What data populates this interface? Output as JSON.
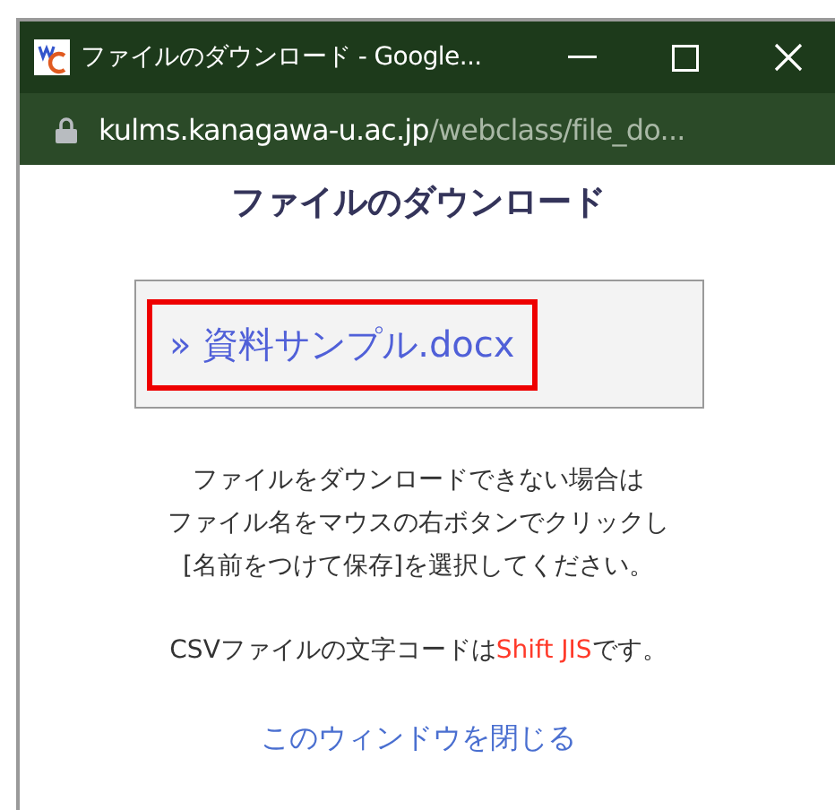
{
  "window": {
    "title": "ファイルのダウンロード - Google..."
  },
  "address_bar": {
    "host": "kulms.kanagawa-u.ac.jp",
    "path": "/webclass/file_do..."
  },
  "heading": "ファイルのダウンロード",
  "file_link": {
    "text": "» 資料サンプル.docx",
    "highlighted": true
  },
  "instructions": [
    "ファイルをダウンロードできない場合は",
    "ファイル名をマウスの右ボタンでクリックし",
    "[名前をつけて保存]を選択してください。"
  ],
  "csv_note": {
    "before": "CSVファイルの文字コードは",
    "emphasis": "Shift JIS",
    "after": "です。"
  },
  "close_link": "このウィンドウを閉じる"
}
